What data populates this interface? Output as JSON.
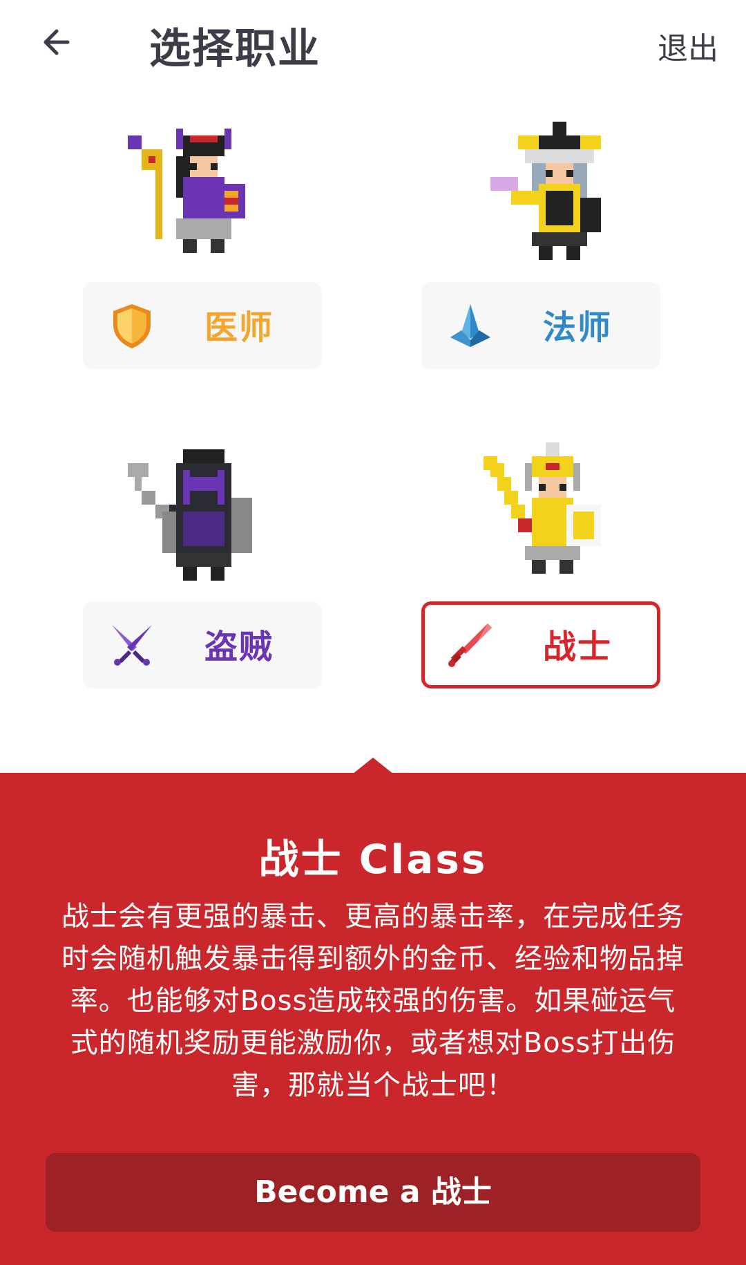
{
  "header": {
    "title": "选择职业",
    "exit_label": "退出"
  },
  "classes": [
    {
      "key": "healer",
      "label": "医师",
      "color": "#f4a52b",
      "icon": "shield-icon",
      "selected": false
    },
    {
      "key": "mage",
      "label": "法师",
      "color": "#2f8ac6",
      "icon": "crystal-icon",
      "selected": false
    },
    {
      "key": "rogue",
      "label": "盗贼",
      "color": "#6a35b3",
      "icon": "crossed-daggers-icon",
      "selected": false
    },
    {
      "key": "warrior",
      "label": "战士",
      "color": "#d7262b",
      "icon": "sword-icon",
      "selected": true
    }
  ],
  "detail": {
    "title": "战士 Class",
    "lines": [
      "战士会有更强的暴击、更高的暴击率，在完成任务",
      "时会随机触发暴击得到额外的金币、经验和物品掉",
      "率。也能够对Boss造成较强的伤害。如果碰运气",
      "式的随机奖励更能激励你，或者想对Boss打出伤",
      "害，那就当个战士吧！"
    ],
    "button_label": "Become a 战士",
    "accent": "#c9272b"
  }
}
